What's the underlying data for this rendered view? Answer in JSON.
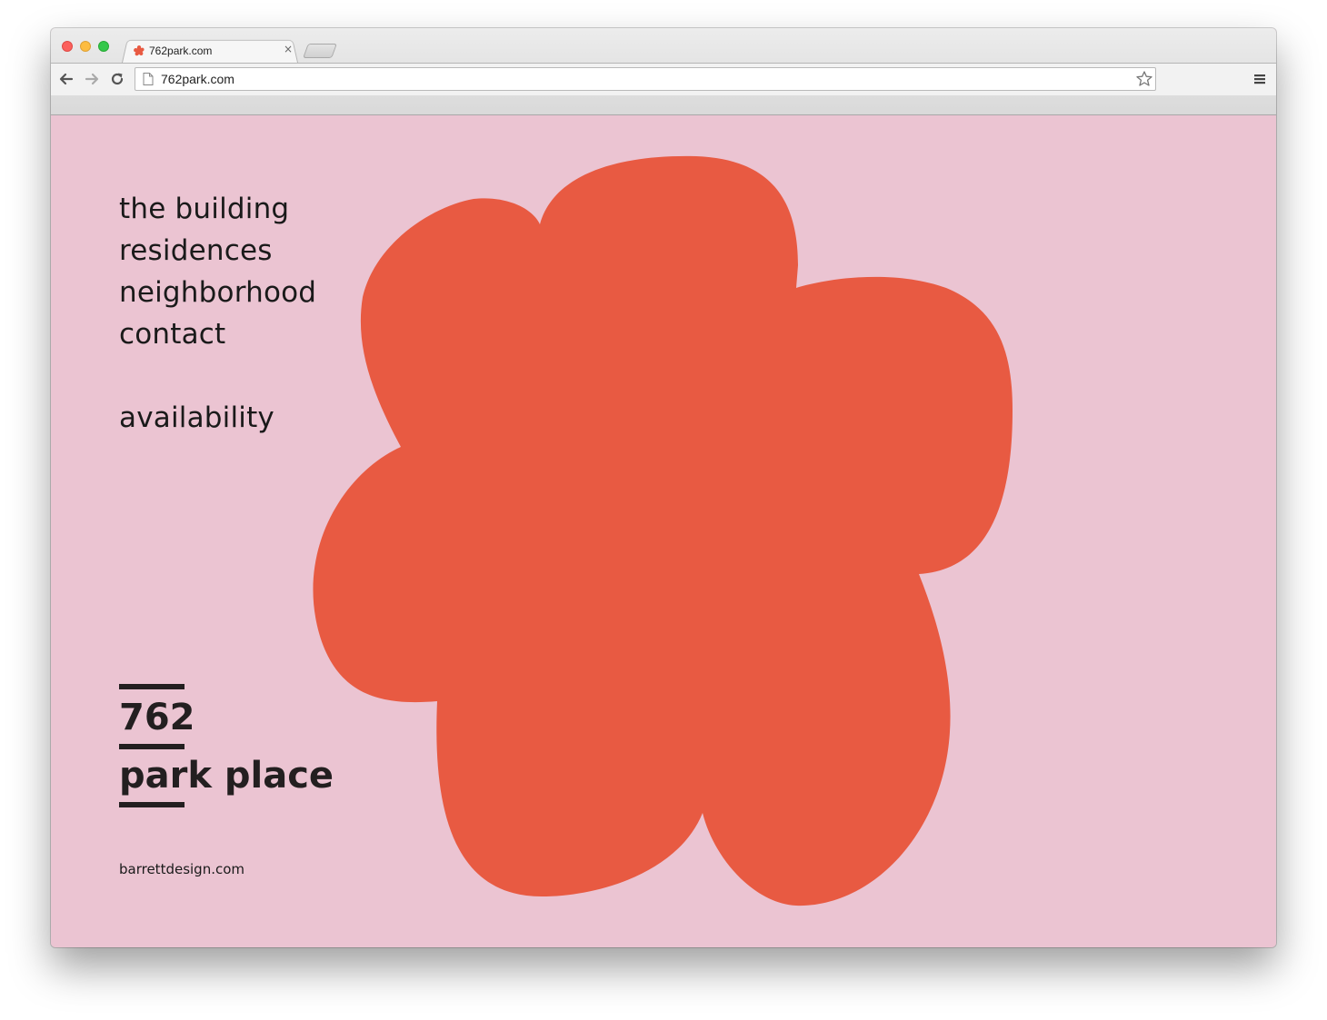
{
  "browser": {
    "tab_title": "762park.com",
    "url": "762park.com",
    "tab_close_glyph": "×",
    "favicon": "red-flower-icon"
  },
  "nav": {
    "items": [
      "the building",
      "residences",
      "neighborhood",
      "contact"
    ],
    "availability": "availability"
  },
  "logo": {
    "number": "762",
    "name": "park place"
  },
  "footer": {
    "credit": "barrettdesign.com"
  },
  "colors": {
    "background": "#ebc4d2",
    "blob": "#e85a42",
    "text": "#1a1a1a"
  }
}
